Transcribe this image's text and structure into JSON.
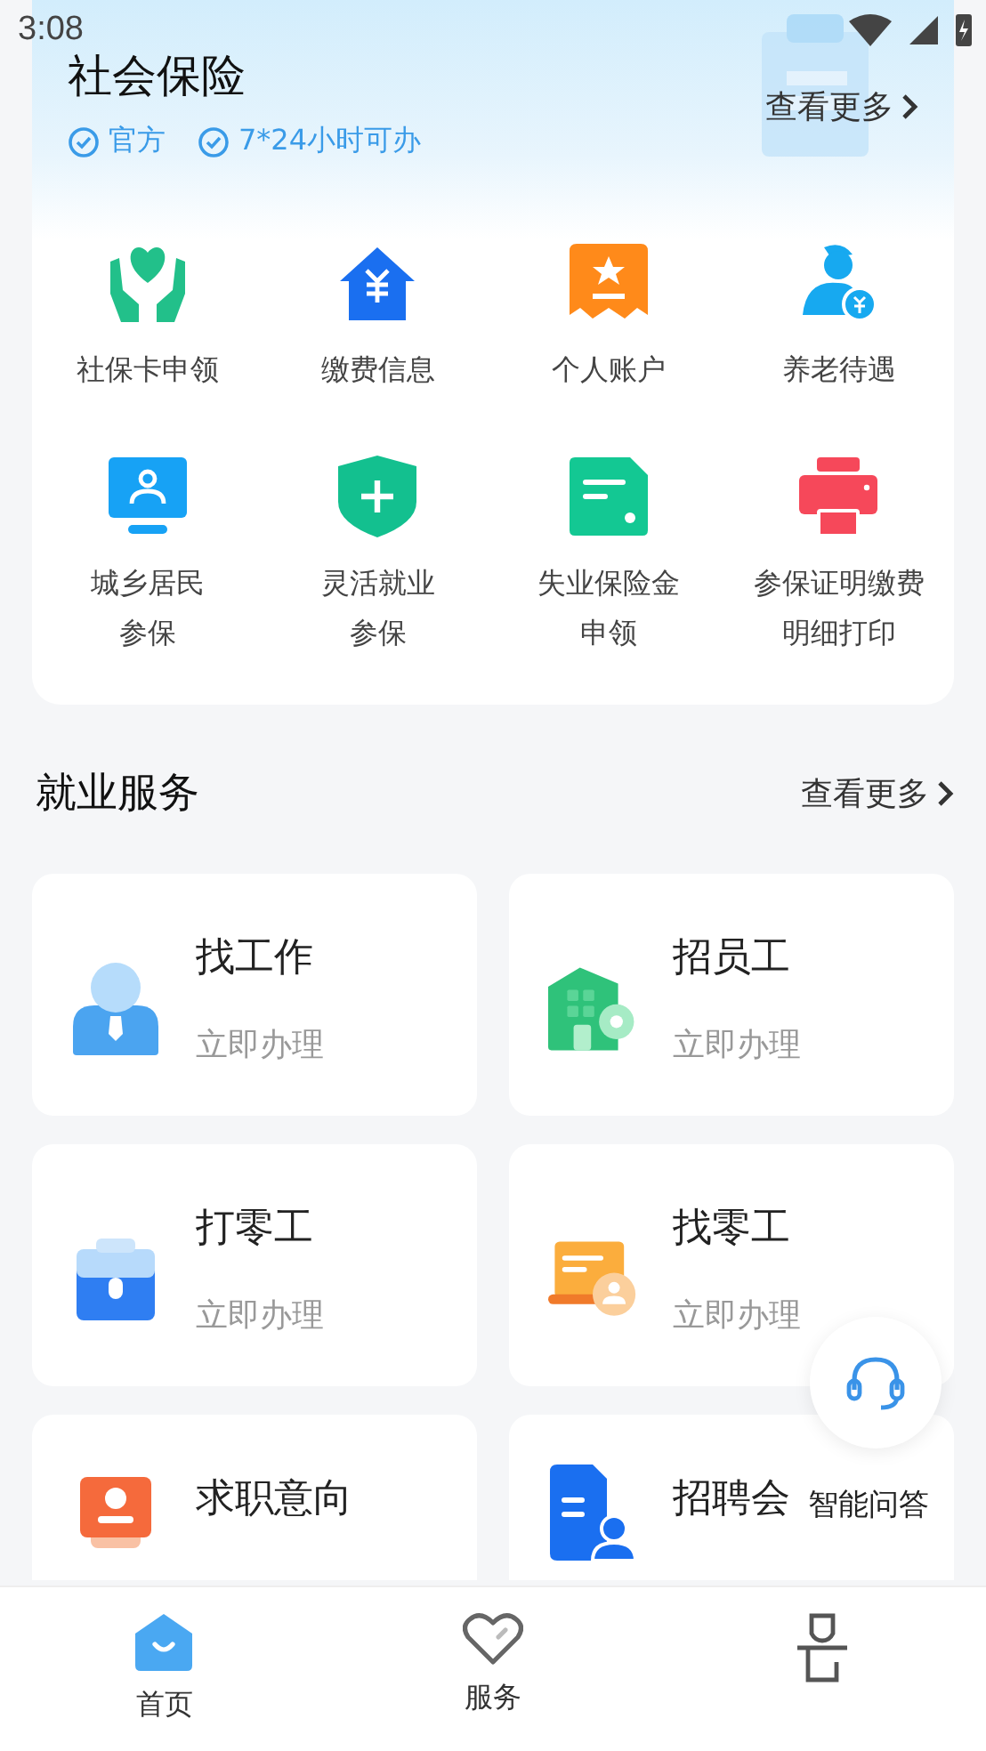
{
  "status_bar": {
    "time": "3:08"
  },
  "social_insurance": {
    "title": "社会保险",
    "more": "查看更多",
    "badges": [
      "官方",
      "7*24小时可办"
    ],
    "items": [
      {
        "label": "社保卡申领",
        "kind": "hands"
      },
      {
        "label": "缴费信息",
        "kind": "house"
      },
      {
        "label": "个人账户",
        "kind": "ticket"
      },
      {
        "label": "养老待遇",
        "kind": "elder"
      },
      {
        "lines": [
          "城乡居民",
          "参保"
        ],
        "kind": "monitor"
      },
      {
        "lines": [
          "灵活就业",
          "参保"
        ],
        "kind": "shield"
      },
      {
        "lines": [
          "失业保险金",
          "申领"
        ],
        "kind": "doc"
      },
      {
        "lines": [
          "参保证明缴费",
          "明细打印"
        ],
        "kind": "printer"
      }
    ]
  },
  "employment": {
    "title": "就业服务",
    "more": "查看更多",
    "cards": [
      {
        "title": "找工作",
        "subtitle": "立即办理",
        "kind": "person"
      },
      {
        "title": "招员工",
        "subtitle": "立即办理",
        "kind": "building"
      },
      {
        "title": "打零工",
        "subtitle": "立即办理",
        "kind": "bag"
      },
      {
        "title": "找零工",
        "subtitle": "立即办理",
        "kind": "laptop"
      },
      {
        "title": "求职意向",
        "kind": "resume"
      },
      {
        "title": "招聘会",
        "kind": "file"
      }
    ]
  },
  "assistant": {
    "label": "智能问答"
  },
  "tab_bar": [
    {
      "label": "首页",
      "selected": true,
      "kind": "home"
    },
    {
      "label": "服务",
      "selected": false,
      "kind": "heart"
    },
    {
      "selected": false,
      "kind": "user"
    }
  ]
}
